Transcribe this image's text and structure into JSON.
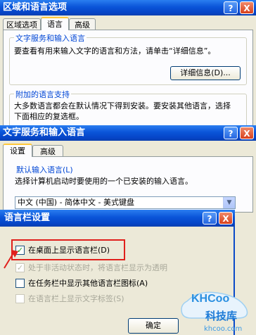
{
  "window1": {
    "title": "区域和语言选项",
    "help_btn": "?",
    "close_btn": "X",
    "tabs": [
      "区域选项",
      "语言",
      "高级"
    ],
    "group1": {
      "legend": "文字服务和输入语言",
      "desc": "要查看有用来输入文字的语言和方法，请单击“详细信息”。",
      "details_button": "详细信息(D)..."
    },
    "group2": {
      "legend": "附加的语言支持",
      "line1": "大多数语言都会在默认情况下得到安装。要安装其他语言，选择",
      "line2": "下面相应的复选框。"
    }
  },
  "window2": {
    "title": "文字服务和输入语言",
    "help_btn": "?",
    "close_btn": "X",
    "tabs": [
      "设置",
      "高级"
    ],
    "default_lang_label": "默认输入语言(L)",
    "default_lang_desc": "选择计算机启动时要使用的一个已安装的输入语言。",
    "default_lang_value": "中文 (中国) - 简体中文 - 美式键盘"
  },
  "window3": {
    "title": "语言栏设置",
    "help_btn": "?",
    "close_btn": "X",
    "options": [
      {
        "label": "在桌面上显示语言栏(D)",
        "checked": true,
        "disabled": false
      },
      {
        "label": "处于非活动状态时，将语言栏显示为透明",
        "checked": true,
        "disabled": true
      },
      {
        "label": "在任务栏中显示其他语言栏图标(A)",
        "checked": false,
        "disabled": false
      },
      {
        "label": "在语言栏上显示文字标签(S)",
        "checked": false,
        "disabled": true
      }
    ],
    "ok_button": "确定"
  },
  "watermark": {
    "logo": "KHCoo",
    "name": "科技库",
    "url": "khcoo.com"
  },
  "colors": {
    "titlebar": "#0a54d8",
    "accent_red": "#e0201c",
    "tab_highlight": "#ffc83c",
    "legend_blue": "#0046d5",
    "watermark_blue": "#2a8fe0"
  }
}
